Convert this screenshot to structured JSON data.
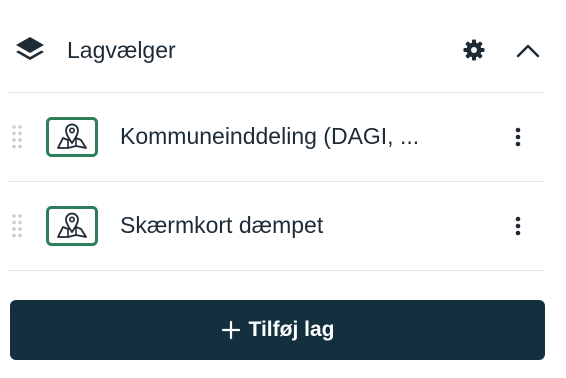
{
  "header": {
    "title": "Lagvælger",
    "icons": {
      "leading": "layers-icon",
      "settings": "gear-icon",
      "collapse": "chevron-up-icon"
    }
  },
  "layers": [
    {
      "label": "Kommuneinddeling (DAGI, ...",
      "icon": "map-pin-icon"
    },
    {
      "label": "Skærmkort dæmpet",
      "icon": "map-pin-icon"
    }
  ],
  "add_button": {
    "label": "Tilføj lag",
    "icon": "plus-icon"
  },
  "colors": {
    "accent": "#2e7d5b",
    "button_bg": "#14303e",
    "text": "#1d2b36",
    "divider": "#e3e6e9"
  }
}
